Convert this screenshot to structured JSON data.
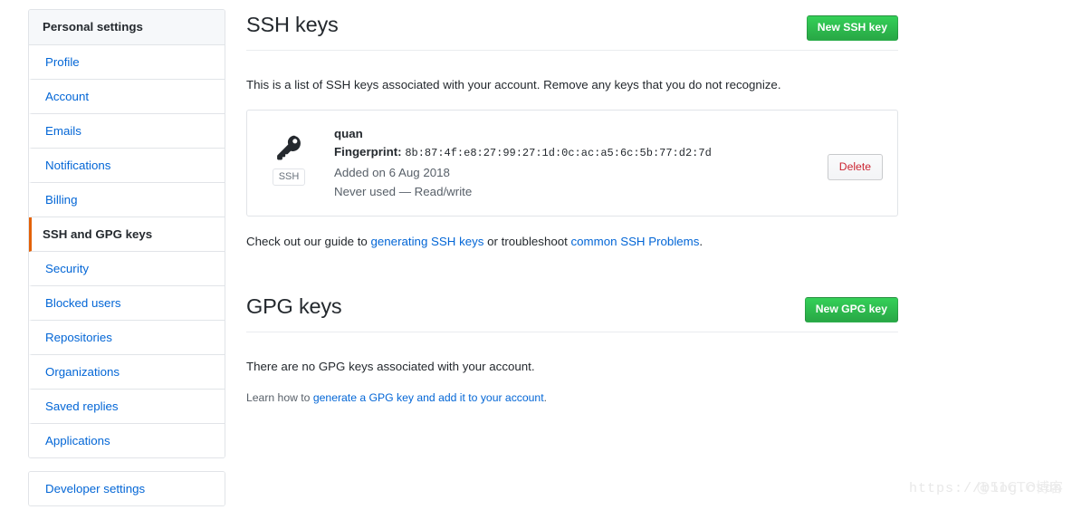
{
  "sidebar": {
    "heading": "Personal settings",
    "items": [
      {
        "label": "Profile",
        "selected": false
      },
      {
        "label": "Account",
        "selected": false
      },
      {
        "label": "Emails",
        "selected": false
      },
      {
        "label": "Notifications",
        "selected": false
      },
      {
        "label": "Billing",
        "selected": false
      },
      {
        "label": "SSH and GPG keys",
        "selected": true
      },
      {
        "label": "Security",
        "selected": false
      },
      {
        "label": "Blocked users",
        "selected": false
      },
      {
        "label": "Repositories",
        "selected": false
      },
      {
        "label": "Organizations",
        "selected": false
      },
      {
        "label": "Saved replies",
        "selected": false
      },
      {
        "label": "Applications",
        "selected": false
      }
    ],
    "developer_settings": "Developer settings"
  },
  "ssh_section": {
    "title": "SSH keys",
    "new_key_button": "New SSH key",
    "description": "This is a list of SSH keys associated with your account. Remove any keys that you do not recognize.",
    "key": {
      "icon_badge": "SSH",
      "name": "quan",
      "fingerprint_label": "Fingerprint:",
      "fingerprint_value": "8b:87:4f:e8:27:99:27:1d:0c:ac:a5:6c:5b:77:d2:7d",
      "added": "Added on 6 Aug 2018",
      "usage": "Never used — Read/write",
      "delete_button": "Delete"
    },
    "help": {
      "prefix": "Check out our guide to ",
      "link1": "generating SSH keys",
      "middle": " or troubleshoot ",
      "link2": "common SSH Problems",
      "suffix": "."
    }
  },
  "gpg_section": {
    "title": "GPG keys",
    "new_key_button": "New GPG key",
    "empty_message": "There are no GPG keys associated with your account.",
    "learn": {
      "prefix": "Learn how to ",
      "link": "generate a GPG key and add it to your account",
      "suffix": "."
    }
  },
  "watermark": {
    "url": "https://blog.csdn",
    "tag": "@51CTO博客"
  },
  "colors": {
    "accent_green": "#2cbe4e",
    "link_blue": "#0366d6",
    "selected_orange": "#e36209",
    "danger_red": "#cb2431"
  }
}
